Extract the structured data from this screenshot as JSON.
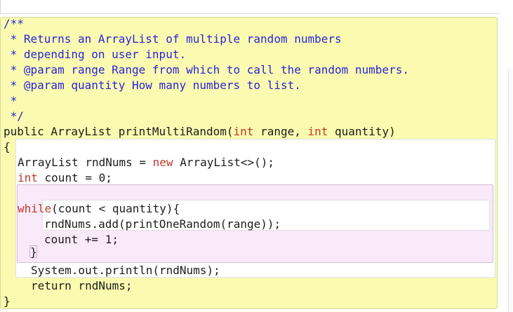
{
  "code": {
    "lines": [
      {
        "text": "/**",
        "kind": "comment"
      },
      {
        "text": " * Returns an ArrayList of multiple random numbers",
        "kind": "comment"
      },
      {
        "text": " * depending on user input.",
        "kind": "comment"
      },
      {
        "text": " * @param range Range from which to call the random numbers.",
        "kind": "comment"
      },
      {
        "text": " * @param quantity How many numbers to list.",
        "kind": "comment"
      },
      {
        "text": " *",
        "kind": "comment"
      },
      {
        "text": " */",
        "kind": "comment"
      },
      {
        "pre": "public ArrayList printMultiRandom(",
        "kw1": "int",
        "mid": " range, ",
        "kw2": "int",
        "post": " quantity)"
      },
      {
        "text": "{"
      },
      {
        "pre": "ArrayList rndNums = ",
        "kw1": "new",
        "post": " ArrayList<>();"
      },
      {
        "kw1": "int",
        "post": " count = 0;"
      },
      {
        "text": ""
      },
      {
        "kw1": "while",
        "post": "(count < quantity){"
      },
      {
        "text": "rndNums.add(printOneRandom(range));"
      },
      {
        "text": "count += 1;"
      },
      {
        "text": "}"
      },
      {
        "text": "System.out.println(rndNums);"
      },
      {
        "text": "return rndNums;"
      },
      {
        "text": "}"
      }
    ]
  },
  "colors": {
    "comment": "#2a24d8",
    "keyword": "#c0392b",
    "editor_bg": "#fafab0",
    "loop_bg": "#f8eaf8"
  }
}
